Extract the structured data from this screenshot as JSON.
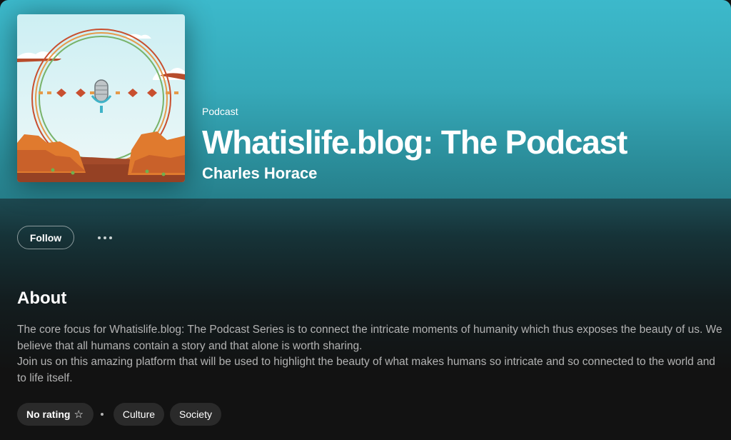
{
  "header": {
    "kind": "Podcast",
    "title": "Whatislife.blog: The Podcast",
    "author": "Charles Horace"
  },
  "actions": {
    "follow_label": "Follow",
    "more_icon": "more-horizontal-icon"
  },
  "about": {
    "heading": "About",
    "lines": [
      "The core focus for Whatislife.blog: The Podcast Series is to connect the intricate moments of humanity which thus exposes the beauty of us. We believe that all humans contain a story and that alone is worth sharing.",
      "Join us on this amazing platform that will be used to highlight the beauty of what makes humans so intricate and so connected to the world and to life itself."
    ]
  },
  "tags": {
    "rating_label": "No rating",
    "rating_icon": "star-outline-icon",
    "items": [
      "Culture",
      "Society"
    ]
  },
  "colors": {
    "hero_top": "#3cb9cb",
    "hero_bottom": "#267f8b",
    "background": "#121212",
    "secondary_text": "#b3b3b3",
    "chip": "#2a2a2a"
  }
}
